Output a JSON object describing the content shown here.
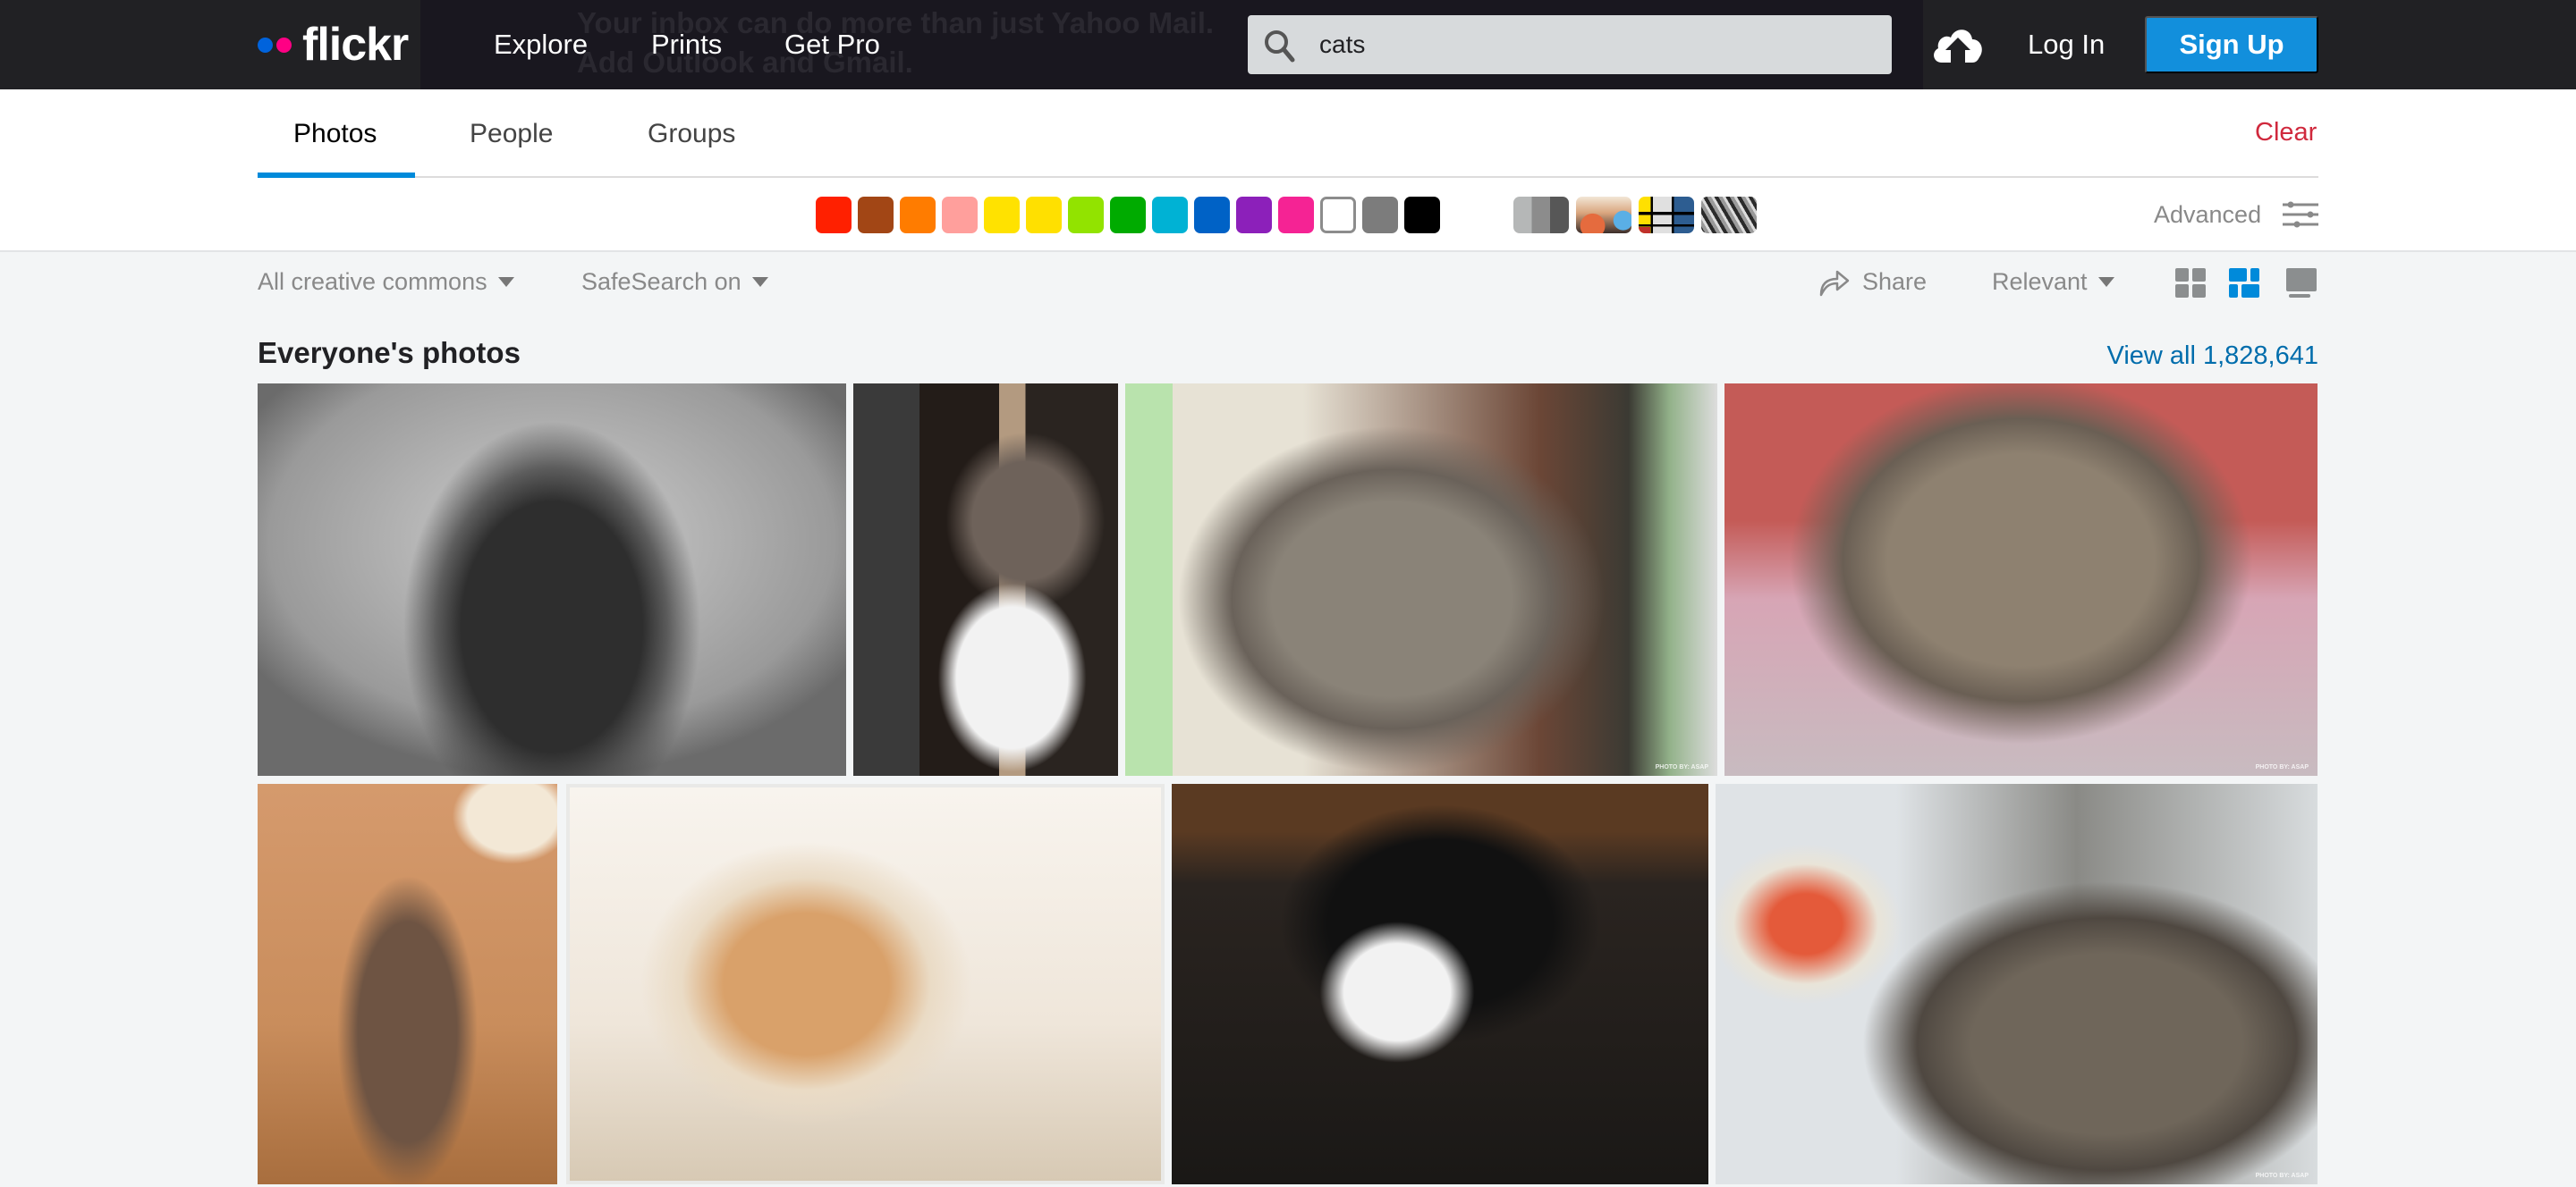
{
  "header": {
    "logo_text": "flickr",
    "background_ad_text_line1": "Your inbox can do more than just Yahoo Mail.",
    "background_ad_text_line2": "Add Outlook and Gmail.",
    "nav": [
      {
        "label": "Explore"
      },
      {
        "label": "Prints"
      },
      {
        "label": "Get Pro"
      }
    ],
    "search": {
      "value": "cats",
      "placeholder": ""
    },
    "upload_icon": "cloud-upload-icon",
    "login_label": "Log In",
    "signup_label": "Sign Up"
  },
  "tabs": [
    {
      "label": "Photos",
      "active": true
    },
    {
      "label": "People",
      "active": false
    },
    {
      "label": "Groups",
      "active": false
    }
  ],
  "clear_label": "Clear",
  "color_filters": [
    {
      "name": "red",
      "hex": "#ff2000"
    },
    {
      "name": "dark-orange",
      "hex": "#a24615"
    },
    {
      "name": "orange",
      "hex": "#ff7c00"
    },
    {
      "name": "pale-pink",
      "hex": "#ff9f9c"
    },
    {
      "name": "lemon-yellow",
      "hex": "#ffe200"
    },
    {
      "name": "school-bus-yellow",
      "hex": "#ffe000"
    },
    {
      "name": "green",
      "hex": "#92e300"
    },
    {
      "name": "dark-lime-green",
      "hex": "#00ab00"
    },
    {
      "name": "cyan",
      "hex": "#00b2d4"
    },
    {
      "name": "blue",
      "hex": "#0062c6"
    },
    {
      "name": "violet",
      "hex": "#8c20ba"
    },
    {
      "name": "pink",
      "hex": "#f52394"
    },
    {
      "name": "white",
      "hex": "#ffffff"
    },
    {
      "name": "gray",
      "hex": "#7c7c7c"
    },
    {
      "name": "black",
      "hex": "#000000"
    }
  ],
  "style_filters": [
    {
      "name": "black-and-white"
    },
    {
      "name": "shallow-depth-of-field"
    },
    {
      "name": "minimalist"
    },
    {
      "name": "patterns"
    }
  ],
  "advanced_label": "Advanced",
  "filters": {
    "license": "All creative commons",
    "safesearch": "SafeSearch on",
    "share_label": "Share",
    "sort": "Relevant",
    "view_modes": [
      {
        "name": "grid-view",
        "active": false
      },
      {
        "name": "justified-view",
        "active": true
      },
      {
        "name": "single-view",
        "active": false
      }
    ]
  },
  "section": {
    "title": "Everyone's photos",
    "view_all": "View all 1,828,641"
  },
  "photos": [
    {
      "subject": "black and white tabby kitten"
    },
    {
      "subject": "tabby and white cat looking left"
    },
    {
      "subject": "tabby cat close-up",
      "caption": "PHOTO BY: ASAP"
    },
    {
      "subject": "tabby cat close-up on pink blanket",
      "caption": "PHOTO BY: ASAP"
    },
    {
      "subject": "cat reaching for plant"
    },
    {
      "subject": "orange kitten"
    },
    {
      "subject": "black and white cat on leather chair"
    },
    {
      "subject": "tabby cat next to Chili mug",
      "caption": "PHOTO BY: ASAP"
    }
  ],
  "colors": {
    "accent_blue": "#128fdc",
    "tab_underline": "#008ada",
    "link_blue": "#006dac",
    "clear_red": "#d0293d",
    "nav_bg": "#212124"
  }
}
